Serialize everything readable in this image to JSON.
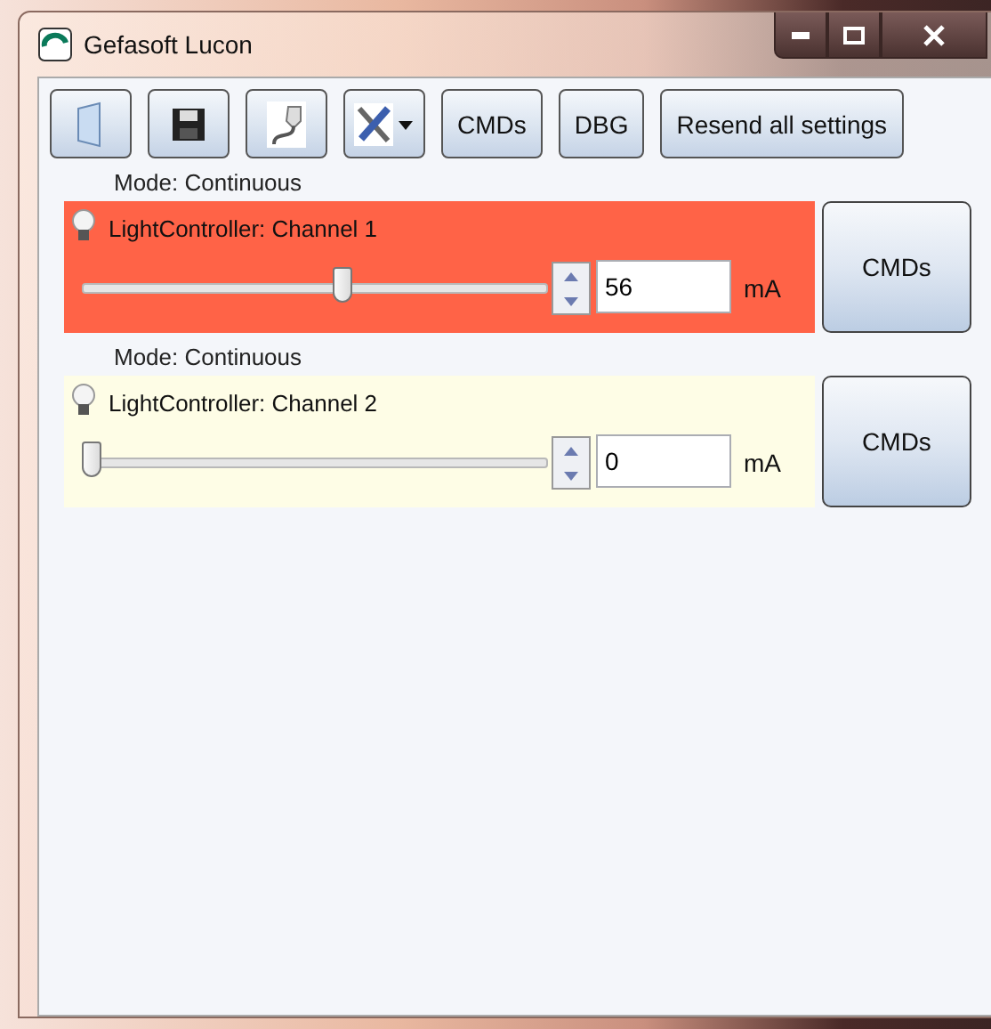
{
  "window": {
    "title": "Gefasoft Lucon"
  },
  "toolbar": [
    {
      "kind": "door"
    },
    {
      "kind": "save"
    },
    {
      "kind": "plug"
    },
    {
      "kind": "tools"
    },
    {
      "kind": "text",
      "label": "CMDs"
    },
    {
      "kind": "text",
      "label": "DBG"
    },
    {
      "kind": "text",
      "label": "Resend all settings"
    }
  ],
  "channels": [
    {
      "mode": "Mode: Continuous",
      "name": "LightController: Channel 1",
      "color": "#ff6347",
      "level": 0.56,
      "value": "56",
      "unit": "mA",
      "button": "CMDs"
    },
    {
      "mode": "Mode: Continuous",
      "name": "LightController: Channel 2",
      "color": "#fefde6",
      "level": 0,
      "value": "0",
      "unit": "mA",
      "button": "CMDs"
    }
  ]
}
